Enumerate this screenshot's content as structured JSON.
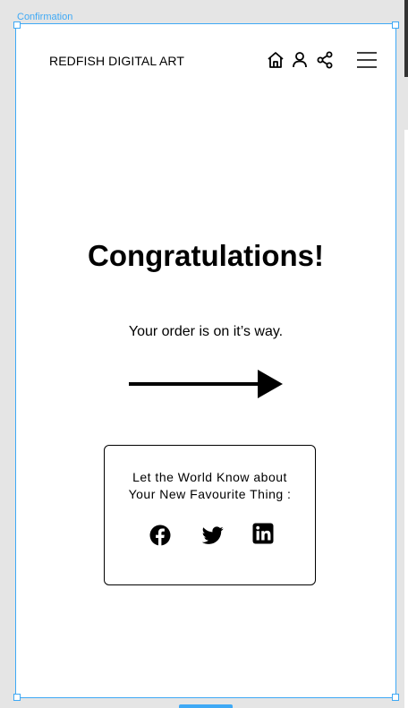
{
  "canvas": {
    "frame_label": "Confirmation",
    "accent_color": "#3fa9f5"
  },
  "header": {
    "brand": "REDFISH DIGITAL ART",
    "icons": [
      "home-icon",
      "user-icon",
      "share-icon",
      "hamburger-menu-icon"
    ]
  },
  "main": {
    "headline": "Congratulations!",
    "message": "Your order is on it’s way.",
    "arrow_icon": "arrow-right-icon"
  },
  "share_card": {
    "line1": "Let the World Know about",
    "line2": "Your New Favourite Thing :",
    "icons": [
      "facebook-icon",
      "twitter-icon",
      "linkedin-icon"
    ]
  }
}
